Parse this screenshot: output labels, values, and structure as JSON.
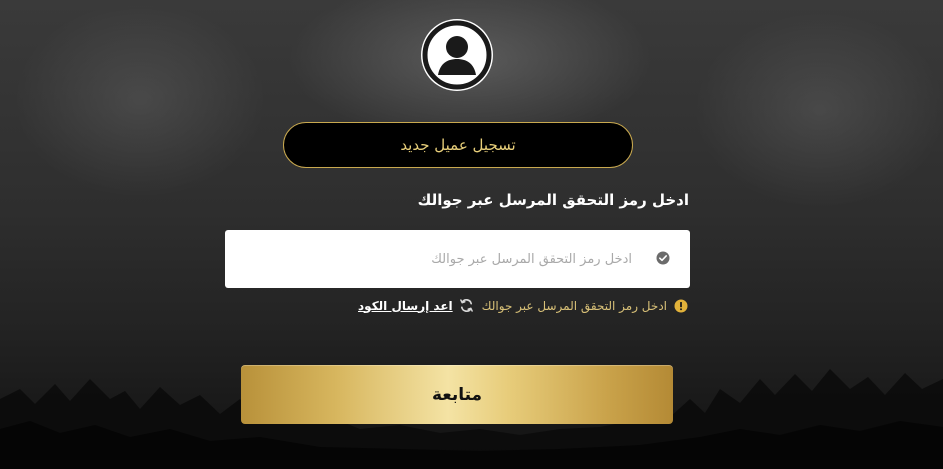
{
  "avatar": {
    "icon": "user-icon"
  },
  "register": {
    "label": "تسجيل عميل جديد"
  },
  "verification": {
    "instruction": "ادخل رمز التحقق المرسل عبر جوالك",
    "input_placeholder": "ادخل رمز التحقق المرسل عبر جوالك",
    "input_value": "",
    "input_icon": "check-circle-icon",
    "hint_icon": "warning-icon",
    "hint_text": "ادخل رمز التحقق المرسل عبر جوالك",
    "resend_icon": "refresh-icon",
    "resend_label": "اعد إرسال الكود"
  },
  "actions": {
    "continue_label": "متابعة"
  },
  "colors": {
    "gold_accent": "#c9a94f",
    "gold_text": "#e8cf7a",
    "hint_text": "#d9c178",
    "warning": "#e2b23a"
  }
}
